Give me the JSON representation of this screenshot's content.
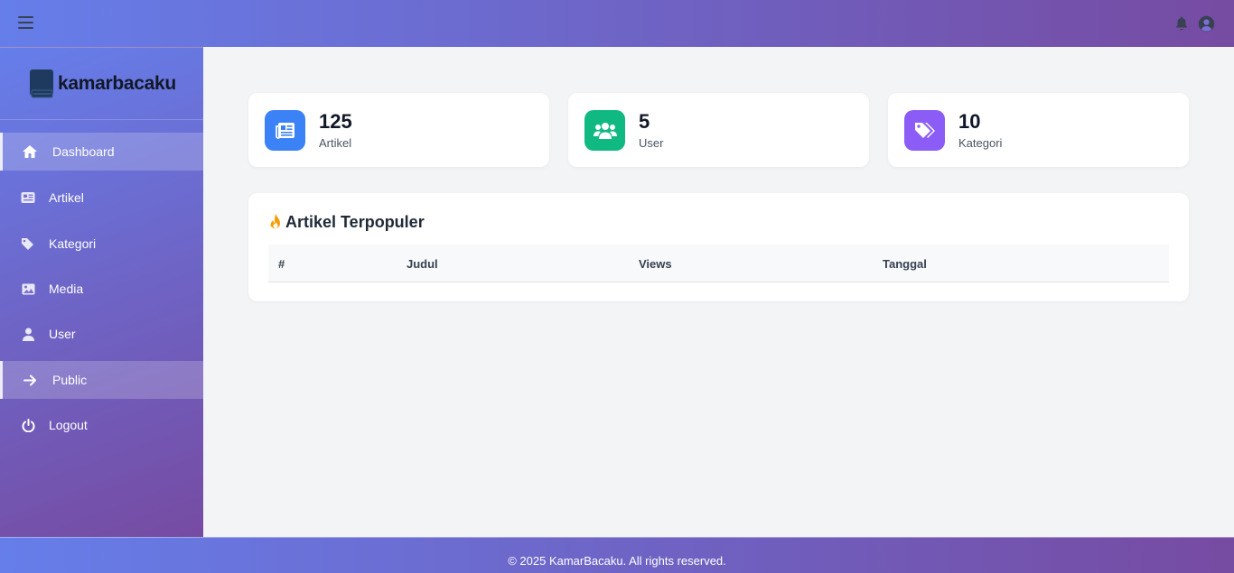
{
  "brand": {
    "name": "kamarbacaku"
  },
  "topbar": {
    "menu_icon": "hamburger-icon",
    "notification_icon": "bell-icon",
    "profile_icon": "user-circle-icon"
  },
  "sidebar": {
    "items": [
      {
        "label": "Dashboard",
        "icon": "home-icon",
        "active": true
      },
      {
        "label": "Artikel",
        "icon": "newspaper-icon",
        "active": false
      },
      {
        "label": "Kategori",
        "icon": "tags-icon",
        "active": false
      },
      {
        "label": "Media",
        "icon": "image-icon",
        "active": false
      },
      {
        "label": "User",
        "icon": "user-icon",
        "active": false
      },
      {
        "label": "Public",
        "icon": "arrow-right-icon",
        "active": true
      },
      {
        "label": "Logout",
        "icon": "power-icon",
        "active": false
      }
    ]
  },
  "stats": [
    {
      "value": "125",
      "label": "Artikel",
      "icon": "newspaper-icon",
      "color": "#3b82f6"
    },
    {
      "value": "5",
      "label": "User",
      "icon": "users-icon",
      "color": "#10b981"
    },
    {
      "value": "10",
      "label": "Kategori",
      "icon": "tags-icon",
      "color": "#8b5cf6"
    }
  ],
  "popular": {
    "title": "Artikel Terpopuler",
    "icon": "fire-icon",
    "columns": [
      "#",
      "Judul",
      "Views",
      "Tanggal"
    ],
    "rows": []
  },
  "footer": {
    "text": "© 2025 KamarBacaku. All rights reserved."
  },
  "colors": {
    "gradient_start": "#667eea",
    "gradient_end": "#764ba2"
  }
}
